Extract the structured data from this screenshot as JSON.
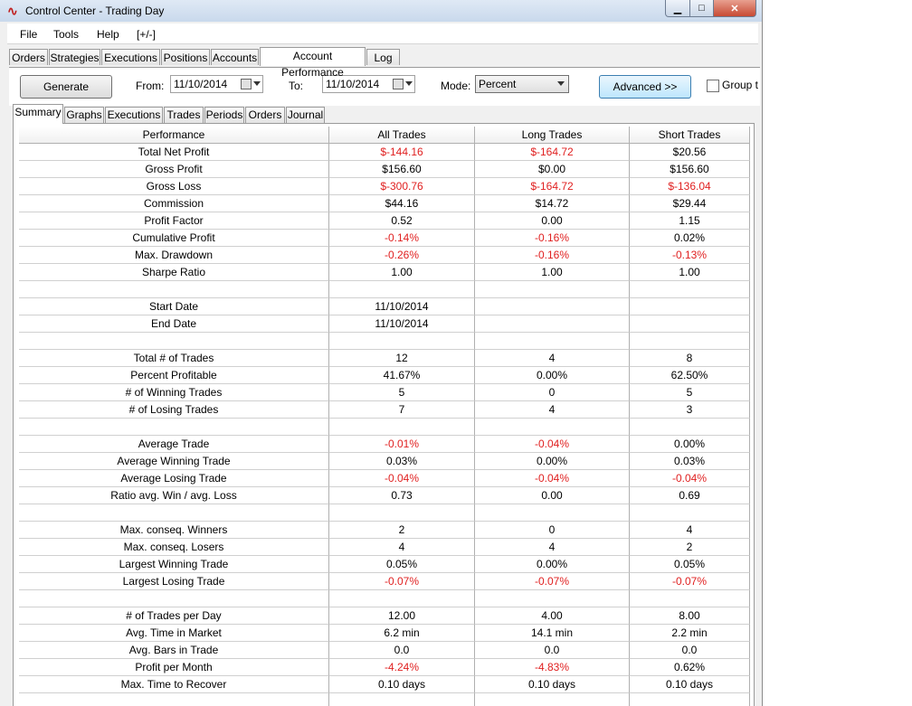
{
  "window": {
    "title": "Control Center - Trading Day"
  },
  "menu": [
    "File",
    "Tools",
    "Help",
    "[+/-]"
  ],
  "main_tabs": [
    "Orders",
    "Strategies",
    "Executions",
    "Positions",
    "Accounts",
    "Account Performance",
    "Log"
  ],
  "toolbar": {
    "generate_label": "Generate",
    "from_label": "From:",
    "from_value": "11/10/2014",
    "to_label": "To:",
    "to_value": "11/10/2014",
    "mode_label": "Mode:",
    "mode_value": "Percent",
    "advanced_label": "Advanced >>",
    "group_label": "Group t"
  },
  "sub_tabs": [
    "Summary",
    "Graphs",
    "Executions",
    "Trades",
    "Periods",
    "Orders",
    "Journal"
  ],
  "table": {
    "headers": [
      "Performance",
      "All Trades",
      "Long Trades",
      "Short Trades"
    ],
    "rows": [
      {
        "label": "Total Net Profit",
        "all": "$-144.16",
        "long": "$-164.72",
        "short": "$20.56",
        "neg": [
          true,
          true,
          false
        ]
      },
      {
        "label": "Gross Profit",
        "all": "$156.60",
        "long": "$0.00",
        "short": "$156.60",
        "neg": [
          false,
          false,
          false
        ]
      },
      {
        "label": "Gross Loss",
        "all": "$-300.76",
        "long": "$-164.72",
        "short": "$-136.04",
        "neg": [
          true,
          true,
          true
        ]
      },
      {
        "label": "Commission",
        "all": "$44.16",
        "long": "$14.72",
        "short": "$29.44",
        "neg": [
          false,
          false,
          false
        ]
      },
      {
        "label": "Profit Factor",
        "all": "0.52",
        "long": "0.00",
        "short": "1.15",
        "neg": [
          false,
          false,
          false
        ]
      },
      {
        "label": "Cumulative Profit",
        "all": "-0.14%",
        "long": "-0.16%",
        "short": "0.02%",
        "neg": [
          true,
          true,
          false
        ]
      },
      {
        "label": "Max. Drawdown",
        "all": "-0.26%",
        "long": "-0.16%",
        "short": "-0.13%",
        "neg": [
          true,
          true,
          true
        ]
      },
      {
        "label": "Sharpe Ratio",
        "all": "1.00",
        "long": "1.00",
        "short": "1.00",
        "neg": [
          false,
          false,
          false
        ]
      },
      {
        "label": "",
        "all": "",
        "long": "",
        "short": "",
        "neg": [
          false,
          false,
          false
        ]
      },
      {
        "label": "Start Date",
        "all": "11/10/2014",
        "long": "",
        "short": "",
        "neg": [
          false,
          false,
          false
        ]
      },
      {
        "label": "End Date",
        "all": "11/10/2014",
        "long": "",
        "short": "",
        "neg": [
          false,
          false,
          false
        ]
      },
      {
        "label": "",
        "all": "",
        "long": "",
        "short": "",
        "neg": [
          false,
          false,
          false
        ]
      },
      {
        "label": "Total # of Trades",
        "all": "12",
        "long": "4",
        "short": "8",
        "neg": [
          false,
          false,
          false
        ]
      },
      {
        "label": "Percent Profitable",
        "all": "41.67%",
        "long": "0.00%",
        "short": "62.50%",
        "neg": [
          false,
          false,
          false
        ]
      },
      {
        "label": "# of Winning Trades",
        "all": "5",
        "long": "0",
        "short": "5",
        "neg": [
          false,
          false,
          false
        ]
      },
      {
        "label": "# of Losing Trades",
        "all": "7",
        "long": "4",
        "short": "3",
        "neg": [
          false,
          false,
          false
        ]
      },
      {
        "label": "",
        "all": "",
        "long": "",
        "short": "",
        "neg": [
          false,
          false,
          false
        ]
      },
      {
        "label": "Average Trade",
        "all": "-0.01%",
        "long": "-0.04%",
        "short": "0.00%",
        "neg": [
          true,
          true,
          false
        ]
      },
      {
        "label": "Average Winning Trade",
        "all": "0.03%",
        "long": "0.00%",
        "short": "0.03%",
        "neg": [
          false,
          false,
          false
        ]
      },
      {
        "label": "Average Losing Trade",
        "all": "-0.04%",
        "long": "-0.04%",
        "short": "-0.04%",
        "neg": [
          true,
          true,
          true
        ]
      },
      {
        "label": "Ratio avg. Win / avg. Loss",
        "all": "0.73",
        "long": "0.00",
        "short": "0.69",
        "neg": [
          false,
          false,
          false
        ]
      },
      {
        "label": "",
        "all": "",
        "long": "",
        "short": "",
        "neg": [
          false,
          false,
          false
        ]
      },
      {
        "label": "Max. conseq. Winners",
        "all": "2",
        "long": "0",
        "short": "4",
        "neg": [
          false,
          false,
          false
        ]
      },
      {
        "label": "Max. conseq. Losers",
        "all": "4",
        "long": "4",
        "short": "2",
        "neg": [
          false,
          false,
          false
        ]
      },
      {
        "label": "Largest Winning Trade",
        "all": "0.05%",
        "long": "0.00%",
        "short": "0.05%",
        "neg": [
          false,
          false,
          false
        ]
      },
      {
        "label": "Largest Losing Trade",
        "all": "-0.07%",
        "long": "-0.07%",
        "short": "-0.07%",
        "neg": [
          true,
          true,
          true
        ]
      },
      {
        "label": "",
        "all": "",
        "long": "",
        "short": "",
        "neg": [
          false,
          false,
          false
        ]
      },
      {
        "label": "# of Trades per Day",
        "all": "12.00",
        "long": "4.00",
        "short": "8.00",
        "neg": [
          false,
          false,
          false
        ]
      },
      {
        "label": "Avg. Time in Market",
        "all": "6.2 min",
        "long": "14.1 min",
        "short": "2.2 min",
        "neg": [
          false,
          false,
          false
        ]
      },
      {
        "label": "Avg. Bars in Trade",
        "all": "0.0",
        "long": "0.0",
        "short": "0.0",
        "neg": [
          false,
          false,
          false
        ]
      },
      {
        "label": "Profit per Month",
        "all": "-4.24%",
        "long": "-4.83%",
        "short": "0.62%",
        "neg": [
          true,
          true,
          false
        ]
      },
      {
        "label": "Max. Time to Recover",
        "all": "0.10 days",
        "long": "0.10 days",
        "short": "0.10 days",
        "neg": [
          false,
          false,
          false
        ]
      },
      {
        "label": "",
        "all": "",
        "long": "",
        "short": "",
        "neg": [
          false,
          false,
          false
        ]
      }
    ]
  },
  "colors": {
    "negative": "#e02020",
    "title_gradient_top": "#dfe9f5"
  }
}
